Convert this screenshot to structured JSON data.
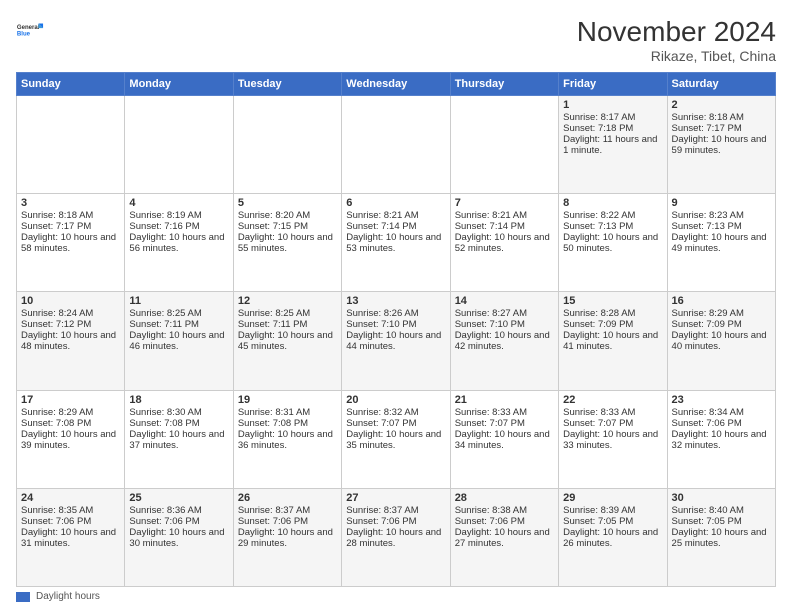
{
  "logo": {
    "line1": "General",
    "line2": "Blue"
  },
  "title": "November 2024",
  "subtitle": "Rikaze, Tibet, China",
  "days_header": [
    "Sunday",
    "Monday",
    "Tuesday",
    "Wednesday",
    "Thursday",
    "Friday",
    "Saturday"
  ],
  "weeks": [
    [
      {
        "num": "",
        "info": ""
      },
      {
        "num": "",
        "info": ""
      },
      {
        "num": "",
        "info": ""
      },
      {
        "num": "",
        "info": ""
      },
      {
        "num": "",
        "info": ""
      },
      {
        "num": "1",
        "info": "Sunrise: 8:17 AM\nSunset: 7:18 PM\nDaylight: 11 hours and 1 minute."
      },
      {
        "num": "2",
        "info": "Sunrise: 8:18 AM\nSunset: 7:17 PM\nDaylight: 10 hours and 59 minutes."
      }
    ],
    [
      {
        "num": "3",
        "info": "Sunrise: 8:18 AM\nSunset: 7:17 PM\nDaylight: 10 hours and 58 minutes."
      },
      {
        "num": "4",
        "info": "Sunrise: 8:19 AM\nSunset: 7:16 PM\nDaylight: 10 hours and 56 minutes."
      },
      {
        "num": "5",
        "info": "Sunrise: 8:20 AM\nSunset: 7:15 PM\nDaylight: 10 hours and 55 minutes."
      },
      {
        "num": "6",
        "info": "Sunrise: 8:21 AM\nSunset: 7:14 PM\nDaylight: 10 hours and 53 minutes."
      },
      {
        "num": "7",
        "info": "Sunrise: 8:21 AM\nSunset: 7:14 PM\nDaylight: 10 hours and 52 minutes."
      },
      {
        "num": "8",
        "info": "Sunrise: 8:22 AM\nSunset: 7:13 PM\nDaylight: 10 hours and 50 minutes."
      },
      {
        "num": "9",
        "info": "Sunrise: 8:23 AM\nSunset: 7:13 PM\nDaylight: 10 hours and 49 minutes."
      }
    ],
    [
      {
        "num": "10",
        "info": "Sunrise: 8:24 AM\nSunset: 7:12 PM\nDaylight: 10 hours and 48 minutes."
      },
      {
        "num": "11",
        "info": "Sunrise: 8:25 AM\nSunset: 7:11 PM\nDaylight: 10 hours and 46 minutes."
      },
      {
        "num": "12",
        "info": "Sunrise: 8:25 AM\nSunset: 7:11 PM\nDaylight: 10 hours and 45 minutes."
      },
      {
        "num": "13",
        "info": "Sunrise: 8:26 AM\nSunset: 7:10 PM\nDaylight: 10 hours and 44 minutes."
      },
      {
        "num": "14",
        "info": "Sunrise: 8:27 AM\nSunset: 7:10 PM\nDaylight: 10 hours and 42 minutes."
      },
      {
        "num": "15",
        "info": "Sunrise: 8:28 AM\nSunset: 7:09 PM\nDaylight: 10 hours and 41 minutes."
      },
      {
        "num": "16",
        "info": "Sunrise: 8:29 AM\nSunset: 7:09 PM\nDaylight: 10 hours and 40 minutes."
      }
    ],
    [
      {
        "num": "17",
        "info": "Sunrise: 8:29 AM\nSunset: 7:08 PM\nDaylight: 10 hours and 39 minutes."
      },
      {
        "num": "18",
        "info": "Sunrise: 8:30 AM\nSunset: 7:08 PM\nDaylight: 10 hours and 37 minutes."
      },
      {
        "num": "19",
        "info": "Sunrise: 8:31 AM\nSunset: 7:08 PM\nDaylight: 10 hours and 36 minutes."
      },
      {
        "num": "20",
        "info": "Sunrise: 8:32 AM\nSunset: 7:07 PM\nDaylight: 10 hours and 35 minutes."
      },
      {
        "num": "21",
        "info": "Sunrise: 8:33 AM\nSunset: 7:07 PM\nDaylight: 10 hours and 34 minutes."
      },
      {
        "num": "22",
        "info": "Sunrise: 8:33 AM\nSunset: 7:07 PM\nDaylight: 10 hours and 33 minutes."
      },
      {
        "num": "23",
        "info": "Sunrise: 8:34 AM\nSunset: 7:06 PM\nDaylight: 10 hours and 32 minutes."
      }
    ],
    [
      {
        "num": "24",
        "info": "Sunrise: 8:35 AM\nSunset: 7:06 PM\nDaylight: 10 hours and 31 minutes."
      },
      {
        "num": "25",
        "info": "Sunrise: 8:36 AM\nSunset: 7:06 PM\nDaylight: 10 hours and 30 minutes."
      },
      {
        "num": "26",
        "info": "Sunrise: 8:37 AM\nSunset: 7:06 PM\nDaylight: 10 hours and 29 minutes."
      },
      {
        "num": "27",
        "info": "Sunrise: 8:37 AM\nSunset: 7:06 PM\nDaylight: 10 hours and 28 minutes."
      },
      {
        "num": "28",
        "info": "Sunrise: 8:38 AM\nSunset: 7:06 PM\nDaylight: 10 hours and 27 minutes."
      },
      {
        "num": "29",
        "info": "Sunrise: 8:39 AM\nSunset: 7:05 PM\nDaylight: 10 hours and 26 minutes."
      },
      {
        "num": "30",
        "info": "Sunrise: 8:40 AM\nSunset: 7:05 PM\nDaylight: 10 hours and 25 minutes."
      }
    ]
  ],
  "legend": {
    "color_label": "Daylight hours"
  }
}
